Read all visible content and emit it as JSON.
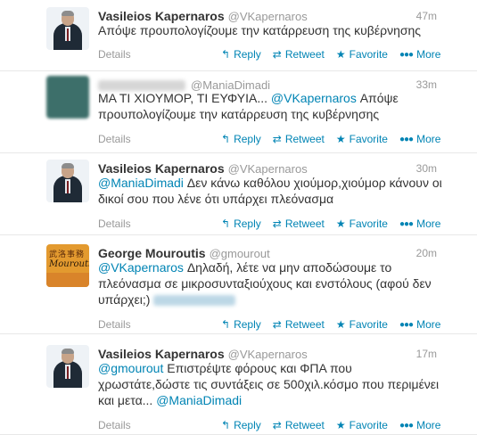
{
  "tweets": [
    {
      "name": "Vasileios Kapernaros",
      "handle": "@VKapernaros",
      "time": "47m",
      "avatar": "politician-photo",
      "segments": [
        {
          "t": "Απόψε προυπολογίζουμε την κατάρρευση της κυβέρνησης",
          "m": false
        }
      ]
    },
    {
      "name": "",
      "name_blurred": true,
      "handle": "@ManiaDimadi",
      "time": "33m",
      "avatar": "blurred",
      "segments": [
        {
          "t": "ΜΑ ΤΙ ΧΙΟΥΜΟΡ, ΤΙ ΕΥΦΥΙΑ... ",
          "m": false
        },
        {
          "t": "@VKapernaros",
          "m": true
        },
        {
          "t": " Απόψε προυπολογίζουμε την κατάρρευση της κυβέρνησης",
          "m": false
        }
      ]
    },
    {
      "name": "Vasileios Kapernaros",
      "handle": "@VKapernaros",
      "time": "30m",
      "avatar": "politician-photo",
      "segments": [
        {
          "t": "@ManiaDimadi",
          "m": true
        },
        {
          "t": " Δεν κάνω καθόλου χιούμορ,χιούμορ κάνουν οι δικοί σου που λένε ότι υπάρχει πλεόνασμα",
          "m": false
        }
      ]
    },
    {
      "name": "George Mouroutis",
      "handle": "@gmourout",
      "time": "20m",
      "avatar": "mouroutis-logo",
      "segments": [
        {
          "t": "@VKapernaros",
          "m": true
        },
        {
          "t": " Δηλαδή, λέτε να μην αποδώσουμε το πλεόνασμα  σε μικροσυνταξιούχους και ενστόλους (αφού δεν υπάρχει;) ",
          "m": false
        },
        {
          "t": "",
          "m": true,
          "blur": true
        }
      ]
    },
    {
      "name": "Vasileios Kapernaros",
      "handle": "@VKapernaros",
      "time": "17m",
      "avatar": "politician-photo",
      "segments": [
        {
          "t": "@gmourout",
          "m": true
        },
        {
          "t": " Επιστρέψτε φόρους και ΦΠΑ που χρωστάτε,δώστε τις συντάξεις σε 500χιλ.κόσμο που περιμένει και μετα... ",
          "m": false
        },
        {
          "t": "@ManiaDimadi",
          "m": true
        }
      ]
    }
  ],
  "actions": {
    "details": "Details",
    "reply": "Reply",
    "retweet": "Retweet",
    "favorite": "Favorite",
    "more": "More"
  },
  "avatar_logo": {
    "glyphs": "武洛事務",
    "script": "Mouroutis"
  },
  "icons": {
    "reply": "reply-icon",
    "retweet": "retweet-icon",
    "favorite": "star-icon",
    "more": "more-dots-icon"
  },
  "colors": {
    "link": "#0084b4",
    "muted": "#999999",
    "text": "#333333"
  }
}
